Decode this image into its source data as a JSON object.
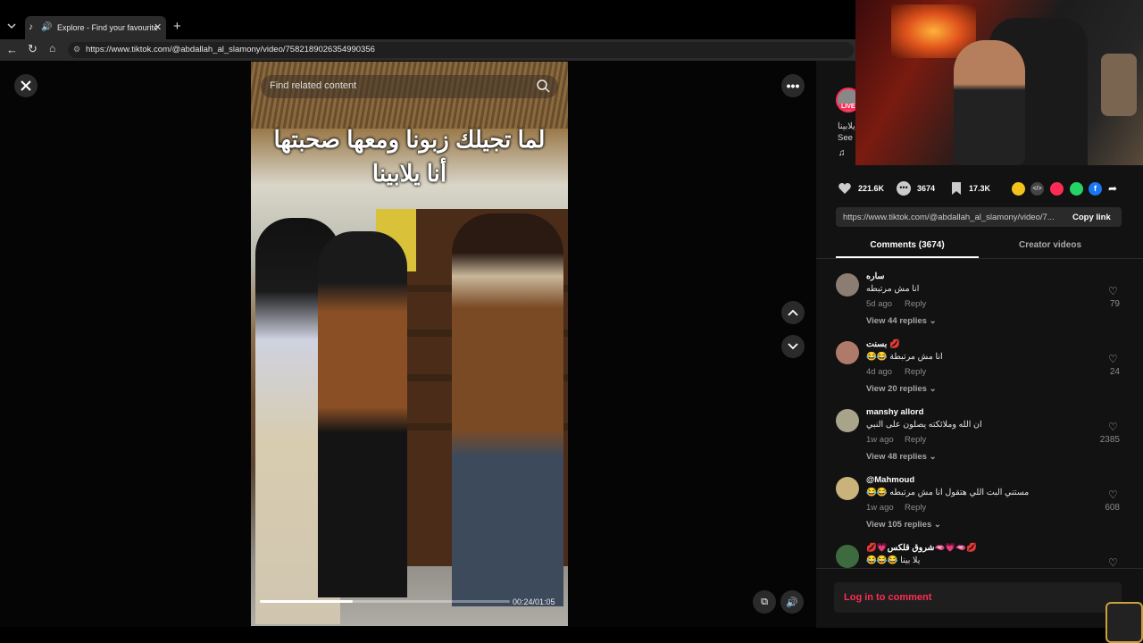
{
  "browser": {
    "tab_title": "Explore - Find your favourite",
    "url": "https://www.tiktok.com/@abdallah_al_slamony/video/7582189026354990356"
  },
  "video": {
    "search_placeholder": "Find related content",
    "caption_line1": "لما تجيلك زبونا ومعها صحبتها",
    "caption_line2": "أنا يلابينا",
    "time": "00:24/01:05",
    "progress_fraction": 0.37
  },
  "panel": {
    "live_badge": "LIVE",
    "desc_partial": "يلابينا",
    "see_more": "See",
    "stats": {
      "likes": "221.6K",
      "comments": "3674",
      "saves": "17.3K"
    },
    "share_url": "https://www.tiktok.com/@abdallah_al_slamony/video/7...",
    "copy_link": "Copy link",
    "tabs": {
      "comments": "Comments (3674)",
      "creator": "Creator videos"
    },
    "login": "Log in to comment"
  },
  "comments": [
    {
      "name": "ساره",
      "text": "انا مش مرتبطه",
      "time": "5d ago",
      "reply": "Reply",
      "likes": "79",
      "view": "View 44 replies",
      "avatar_color": "#8c7d72"
    },
    {
      "name": "بسنت 💋",
      "text": "انا مش مرتبطة 😂😂",
      "time": "4d ago",
      "reply": "Reply",
      "likes": "24",
      "view": "View 20 replies",
      "avatar_color": "#b07a6a"
    },
    {
      "name": "manshy allord",
      "text": "ان الله وملائكته يصلون على النبي",
      "time": "1w ago",
      "reply": "Reply",
      "likes": "2385",
      "view": "View 48 replies",
      "avatar_color": "#a8a48a"
    },
    {
      "name": "@Mahmoud",
      "text": "مستني البت اللي هتقول انا مش مرتبطه 😂😂",
      "time": "1w ago",
      "reply": "Reply",
      "likes": "608",
      "view": "View 105 replies",
      "avatar_color": "#c9b37a"
    },
    {
      "name": "💋💗شروق قلكس🫦💗🫦💋",
      "text": "يلا بينا 😂😂😂",
      "time": "",
      "reply": "",
      "likes": "",
      "view": "",
      "avatar_color": "#3d6b3f"
    }
  ],
  "colors": {
    "accent": "#fe2c55",
    "panel_bg": "#121212",
    "chrome_bg": "#2b2b2b"
  },
  "icons": [
    "close-icon",
    "search-icon",
    "more-icon",
    "chevron-up-icon",
    "chevron-down-icon",
    "heart-icon",
    "comment-icon",
    "bookmark-icon",
    "volume-icon",
    "pip-icon",
    "share-icons"
  ]
}
